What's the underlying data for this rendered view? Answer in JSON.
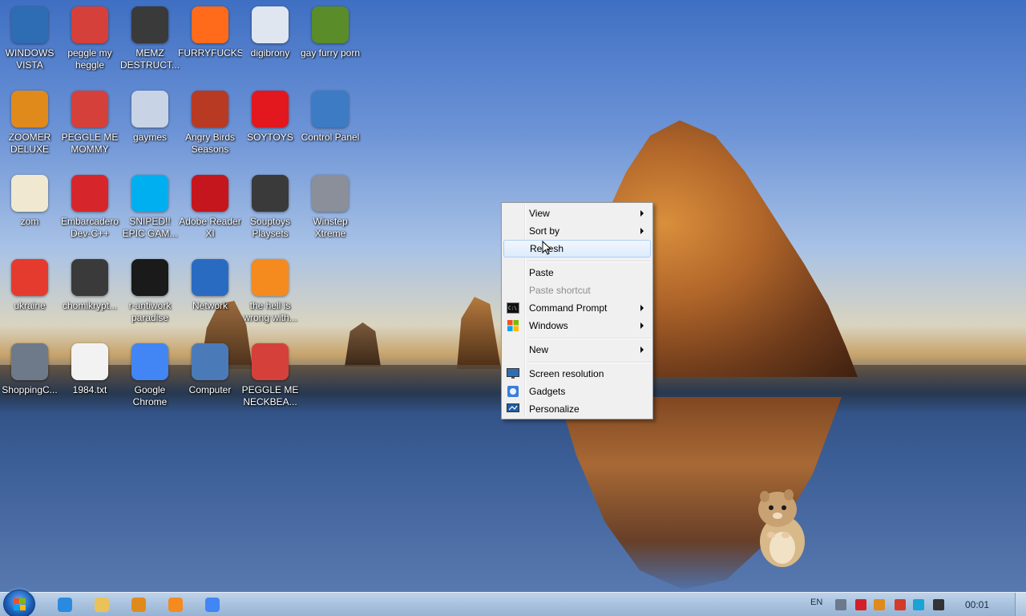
{
  "desktop": {
    "icons": [
      {
        "label": "WINDOWS VISTA",
        "icon": "vista-orb-icon",
        "color": "#2e6db4"
      },
      {
        "label": "peggle my heggle",
        "icon": "peggle-icon",
        "color": "#d6403a"
      },
      {
        "label": "MEMZ DESTRUCT...",
        "icon": "clock-file-icon",
        "color": "#3a3a3a"
      },
      {
        "label": "FURRYFUCKS",
        "icon": "firefox-icon",
        "color": "#ff6b1a"
      },
      {
        "label": "digibrony",
        "icon": "document-icon",
        "color": "#dfe6ef"
      },
      {
        "label": "gay furry porn",
        "icon": "box-game-icon",
        "color": "#5a8c2a"
      },
      {
        "label": "ZOOMER DELUXE",
        "icon": "zoomer-icon",
        "color": "#e08a1c"
      },
      {
        "label": "PEGGLE ME MOMMY",
        "icon": "peggle-icon",
        "color": "#d6403a"
      },
      {
        "label": "gaymes",
        "icon": "cards-icon",
        "color": "#c8d3e6"
      },
      {
        "label": "Angry Birds Seasons",
        "icon": "angry-birds-icon",
        "color": "#b83a22"
      },
      {
        "label": "SOYTOYS",
        "icon": "s-logo-icon",
        "color": "#e3171e"
      },
      {
        "label": "Control Panel",
        "icon": "control-panel-icon",
        "color": "#3d7bc4"
      },
      {
        "label": "zom",
        "icon": "flower-icon",
        "color": "#f0e8d0"
      },
      {
        "label": "Embarcadero Dev-C++",
        "icon": "devcpp-icon",
        "color": "#d7262b"
      },
      {
        "label": "SNIPED!! EPIC GAM...",
        "icon": "skype-icon",
        "color": "#00aff0"
      },
      {
        "label": "Adobe Reader XI",
        "icon": "pdf-icon",
        "color": "#c4161c"
      },
      {
        "label": "Souptoys Playsets",
        "icon": "clock-file-icon",
        "color": "#3a3a3a"
      },
      {
        "label": "Winstep Xtreme",
        "icon": "winstep-icon",
        "color": "#8a8f99"
      },
      {
        "label": "ukraine",
        "icon": "radiation-icon",
        "color": "#e53b2f"
      },
      {
        "label": "chomikrypt...",
        "icon": "clock-file-icon",
        "color": "#3a3a3a"
      },
      {
        "label": "r-antiwork paradise",
        "icon": "antiwork-icon",
        "color": "#1a1a1a"
      },
      {
        "label": "Network",
        "icon": "network-icon",
        "color": "#2a6bc2"
      },
      {
        "label": "the hell is wrong with...",
        "icon": "uc-browser-icon",
        "color": "#f58a1f"
      },
      {
        "label": "ShoppingC...",
        "icon": "flash-icon",
        "color": "#6e7a8a"
      },
      {
        "label": "1984.txt",
        "icon": "text-file-icon",
        "color": "#f2f2f2"
      },
      {
        "label": "Google Chrome",
        "icon": "chrome-icon",
        "color": "#4285f4"
      },
      {
        "label": "Computer",
        "icon": "computer-icon",
        "color": "#4a7bb8"
      },
      {
        "label": "PEGGLE ME NECKBEA...",
        "icon": "peggle-icon",
        "color": "#d6403a"
      }
    ]
  },
  "context_menu": {
    "items": [
      {
        "label": "View",
        "submenu": true
      },
      {
        "label": "Sort by",
        "submenu": true
      },
      {
        "label": "Refresh",
        "highlighted": true
      },
      {
        "label": "Paste"
      },
      {
        "label": "Paste shortcut",
        "disabled": true
      },
      {
        "label": "Command Prompt",
        "submenu": true,
        "icon": "cmd-icon"
      },
      {
        "label": "Windows",
        "submenu": true,
        "icon": "windows-flag-icon"
      },
      {
        "label": "New",
        "submenu": true
      },
      {
        "label": "Screen resolution",
        "icon": "screen-resolution-icon"
      },
      {
        "label": "Gadgets",
        "icon": "gadgets-icon"
      },
      {
        "label": "Personalize",
        "icon": "personalize-icon"
      }
    ]
  },
  "taskbar": {
    "pinned": [
      {
        "name": "internet-explorer-icon",
        "color": "#2a8ae0"
      },
      {
        "name": "file-explorer-icon",
        "color": "#e9c25a"
      },
      {
        "name": "media-player-icon",
        "color": "#e08a1c"
      },
      {
        "name": "uc-browser-icon",
        "color": "#f58a1f"
      },
      {
        "name": "chrome-icon",
        "color": "#4285f4"
      }
    ],
    "tray": {
      "language": "EN",
      "icons": [
        {
          "name": "network-tray-icon",
          "color": "#6b7a8c"
        },
        {
          "name": "antivirus-tray-icon",
          "color": "#d21f2a"
        },
        {
          "name": "search-tray-icon",
          "color": "#e08a1c"
        },
        {
          "name": "flag-tray-icon",
          "color": "#d33a2a"
        },
        {
          "name": "display-tray-icon",
          "color": "#1aa3d6"
        },
        {
          "name": "volume-tray-icon",
          "color": "#333333"
        }
      ],
      "clock": "00:01"
    }
  }
}
